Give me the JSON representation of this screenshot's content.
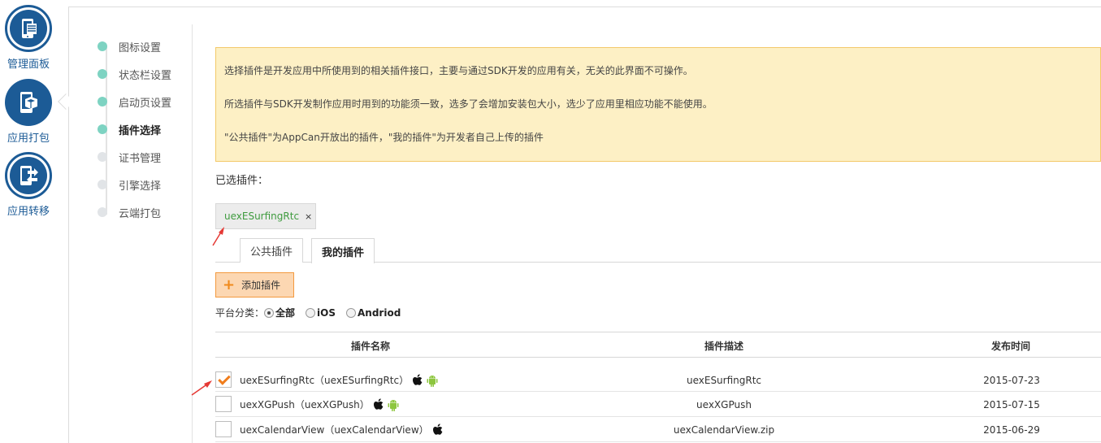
{
  "rail": {
    "items": [
      {
        "label": "管理面板"
      },
      {
        "label": "应用打包"
      },
      {
        "label": "应用转移"
      }
    ]
  },
  "steps": [
    {
      "label": "图标设置",
      "state": "done"
    },
    {
      "label": "状态栏设置",
      "state": "done"
    },
    {
      "label": "启动页设置",
      "state": "done"
    },
    {
      "label": "插件选择",
      "state": "active"
    },
    {
      "label": "证书管理",
      "state": "pending"
    },
    {
      "label": "引擎选择",
      "state": "pending"
    },
    {
      "label": "云端打包",
      "state": "pending"
    }
  ],
  "notice": {
    "line1": "选择插件是开发应用中所使用到的相关插件接口，主要与通过SDK开发的应用有关，无关的此界面不可操作。",
    "line2": "所选插件与SDK开发制作应用时用到的功能须一致，选多了会增加安装包大小，选少了应用里相应功能不能使用。",
    "line3": "\"公共插件\"为AppCan开放出的插件，\"我的插件\"为开发者自己上传的插件"
  },
  "selected": {
    "label": "已选插件：",
    "chip": "uexESurfingRtc",
    "remove": "×"
  },
  "tabs": [
    {
      "label": "公共插件",
      "active": false
    },
    {
      "label": "我的插件",
      "active": true
    }
  ],
  "add_button": {
    "plus": "+",
    "label": "添加插件"
  },
  "platform_filter": {
    "label": "平台分类：",
    "options": [
      {
        "label": "全部",
        "checked": true
      },
      {
        "label": "iOS",
        "checked": false
      },
      {
        "label": "Andriod",
        "checked": false
      }
    ]
  },
  "table": {
    "headers": {
      "name": "插件名称",
      "desc": "插件描述",
      "date": "发布时间"
    },
    "rows": [
      {
        "name": "uexESurfingRtc（uexESurfingRtc）",
        "desc": "uexESurfingRtc",
        "date": "2015-07-23",
        "checked": true,
        "ios": true,
        "android": true
      },
      {
        "name": "uexXGPush（uexXGPush）",
        "desc": "uexXGPush",
        "date": "2015-07-15",
        "checked": false,
        "ios": true,
        "android": true
      },
      {
        "name": "uexCalendarView（uexCalendarView）",
        "desc": "uexCalendarView.zip",
        "date": "2015-06-29",
        "checked": false,
        "ios": true,
        "android": false
      }
    ]
  },
  "colors": {
    "brand_blue": "#1c5b96",
    "step_done": "#7ed3c2",
    "notice_bg": "#fdf0c5",
    "accent_orange": "#f08a1c",
    "chip_text": "#3f9b3f",
    "android_green": "#8dc63f"
  }
}
